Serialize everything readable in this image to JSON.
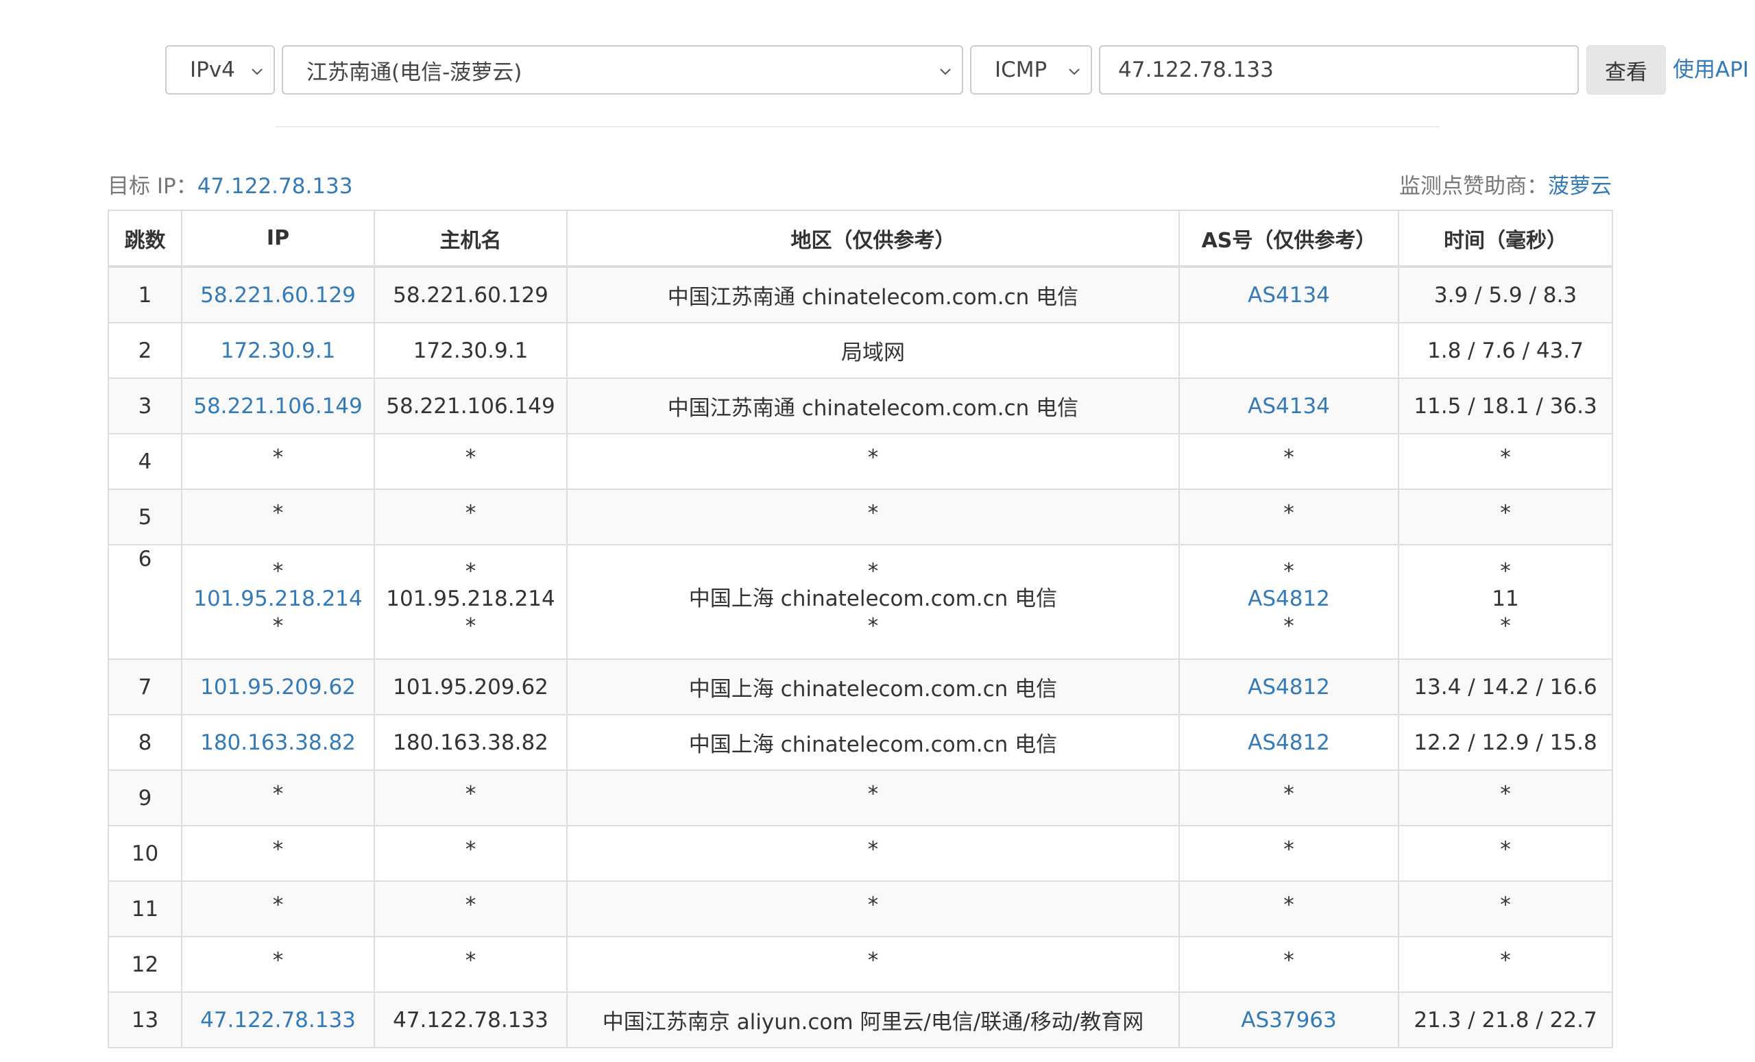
{
  "toolbar": {
    "ip_version": "IPv4",
    "node": "江苏南通(电信-菠萝云)",
    "protocol": "ICMP",
    "target_input": "47.122.78.133",
    "search_button": "查看",
    "api_link": "使用API"
  },
  "meta": {
    "target_label": "目标 IP：",
    "target_ip": "47.122.78.133",
    "sponsor_label": "监测点赞助商：",
    "sponsor_name": "菠萝云"
  },
  "table": {
    "headers": [
      "跳数",
      "IP",
      "主机名",
      "地区（仅供参考）",
      "AS号（仅供参考）",
      "时间（毫秒）"
    ],
    "rows": [
      {
        "hop": "1",
        "ip": "58.221.60.129",
        "host": "58.221.60.129",
        "region": "中国江苏南通 chinatelecom.com.cn 电信",
        "asn": "AS4134",
        "time": "3.9 / 5.9 / 8.3"
      },
      {
        "hop": "2",
        "ip": "172.30.9.1",
        "host": "172.30.9.1",
        "region": "局域网",
        "asn": "",
        "time": "1.8 / 7.6 / 43.7"
      },
      {
        "hop": "3",
        "ip": "58.221.106.149",
        "host": "58.221.106.149",
        "region": "中国江苏南通 chinatelecom.com.cn 电信",
        "asn": "AS4134",
        "time": "11.5 / 18.1 / 36.3"
      },
      {
        "hop": "4",
        "ip": "*",
        "host": "*",
        "region": "*",
        "asn": "*",
        "time": "*"
      },
      {
        "hop": "5",
        "ip": "*",
        "host": "*",
        "region": "*",
        "asn": "*",
        "time": "*"
      },
      {
        "hop": "6",
        "ip": [
          "*",
          "101.95.218.214",
          "*"
        ],
        "host": [
          "*",
          "101.95.218.214",
          "*"
        ],
        "region": [
          "*",
          "中国上海 chinatelecom.com.cn 电信",
          "*"
        ],
        "asn": [
          "*",
          "AS4812",
          "*"
        ],
        "time": [
          "*",
          "11",
          "*"
        ]
      },
      {
        "hop": "7",
        "ip": "101.95.209.62",
        "host": "101.95.209.62",
        "region": "中国上海 chinatelecom.com.cn 电信",
        "asn": "AS4812",
        "time": "13.4 / 14.2 / 16.6"
      },
      {
        "hop": "8",
        "ip": "180.163.38.82",
        "host": "180.163.38.82",
        "region": "中国上海 chinatelecom.com.cn 电信",
        "asn": "AS4812",
        "time": "12.2 / 12.9 / 15.8"
      },
      {
        "hop": "9",
        "ip": "*",
        "host": "*",
        "region": "*",
        "asn": "*",
        "time": "*"
      },
      {
        "hop": "10",
        "ip": "*",
        "host": "*",
        "region": "*",
        "asn": "*",
        "time": "*"
      },
      {
        "hop": "11",
        "ip": "*",
        "host": "*",
        "region": "*",
        "asn": "*",
        "time": "*"
      },
      {
        "hop": "12",
        "ip": "*",
        "host": "*",
        "region": "*",
        "asn": "*",
        "time": "*"
      },
      {
        "hop": "13",
        "ip": "47.122.78.133",
        "host": "47.122.78.133",
        "region": "中国江苏南京 aliyun.com 阿里云/电信/联通/移动/教育网",
        "asn": "AS37963",
        "time": "21.3 / 21.8 / 22.7"
      }
    ]
  },
  "colors": {
    "link": "#337ab7",
    "border": "#dddddd",
    "stripe": "#f9f9f9",
    "button_bg": "#e6e6e6"
  }
}
